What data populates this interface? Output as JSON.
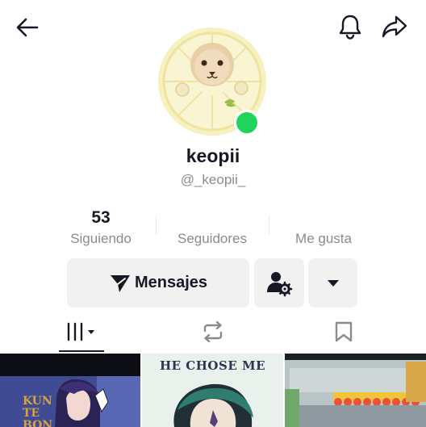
{
  "header": {
    "back_icon": "arrow-left-icon",
    "notifications_icon": "bell-icon",
    "share_icon": "share-arrow-icon"
  },
  "profile": {
    "display_name": "keopii",
    "username": "@_keopii_",
    "online": true,
    "online_color": "#20d35a"
  },
  "stats": {
    "following": {
      "value": "53",
      "label": "Siguiendo"
    },
    "followers": {
      "value": "",
      "label": "Seguidores"
    },
    "likes": {
      "value": "",
      "label": "Me gusta"
    }
  },
  "actions": {
    "message_label": "Mensajes",
    "message_icon": "send-icon",
    "user_settings_icon": "user-gear-icon",
    "more_icon": "caret-down-icon",
    "button_bg": "#f1f1f2"
  },
  "tabs": [
    {
      "name": "videos",
      "icon": "grid-bars-icon",
      "active": true
    },
    {
      "name": "reposts",
      "icon": "repost-icon",
      "active": false
    },
    {
      "name": "saved",
      "icon": "bookmark-icon",
      "active": false
    }
  ],
  "grid": {
    "thumbnails": [
      {
        "caption": "KUN TE BON"
      },
      {
        "caption": "HE CHOSE ME"
      },
      {
        "caption": ""
      }
    ]
  }
}
